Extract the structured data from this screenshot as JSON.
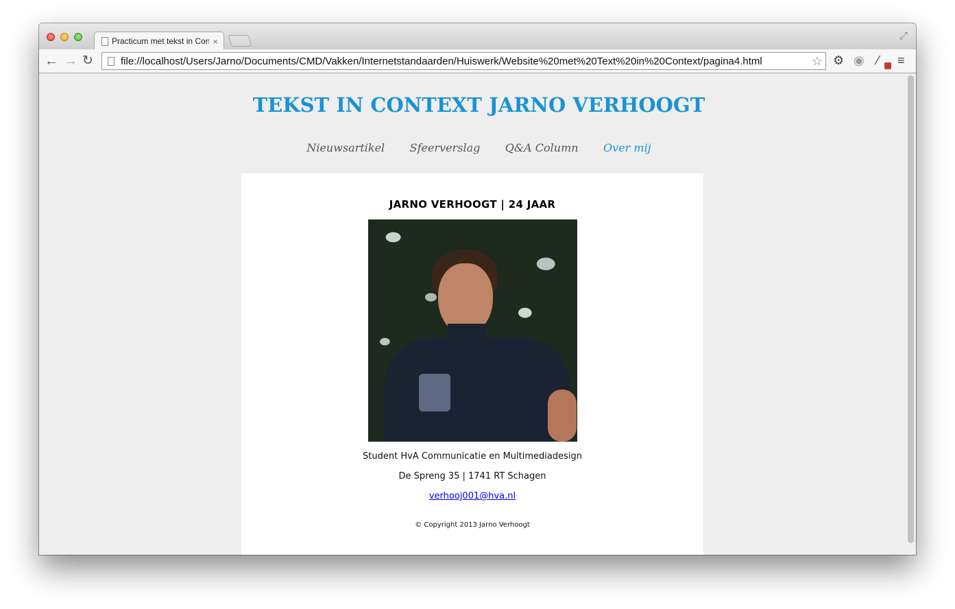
{
  "browser": {
    "tab_title": "Practicum met tekst in Con",
    "tab_close": "×",
    "url": "file://localhost/Users/Jarno/Documents/CMD/Vakken/Internetstandaarden/Huiswerk/Website%20met%20Text%20in%20Context/pagina4.html",
    "icons": {
      "back": "←",
      "forward": "→",
      "reload": "↻",
      "star": "☆",
      "settings": "⚙",
      "extension": "◉",
      "dropper": "⁄",
      "menu": "≡",
      "fullscreen": "⤢"
    }
  },
  "site": {
    "title": "TEKST IN CONTEXT JARNO VERHOOGT",
    "nav": [
      {
        "label": "Nieuwsartikel",
        "active": false
      },
      {
        "label": "Sfeerverslag",
        "active": false
      },
      {
        "label": "Q&A Column",
        "active": false
      },
      {
        "label": "Over mij",
        "active": true
      }
    ],
    "accent_color": "#1a93d5"
  },
  "profile": {
    "heading": "JARNO VERHOOGT | 24 JAAR",
    "study": "Student HvA Communicatie en Multimediadesign",
    "address": "De Spreng 35 | 1741 RT Schagen",
    "email": "verhooj001@hva.nl",
    "copyright": "© Copyright 2013 Jarno Verhoogt"
  }
}
